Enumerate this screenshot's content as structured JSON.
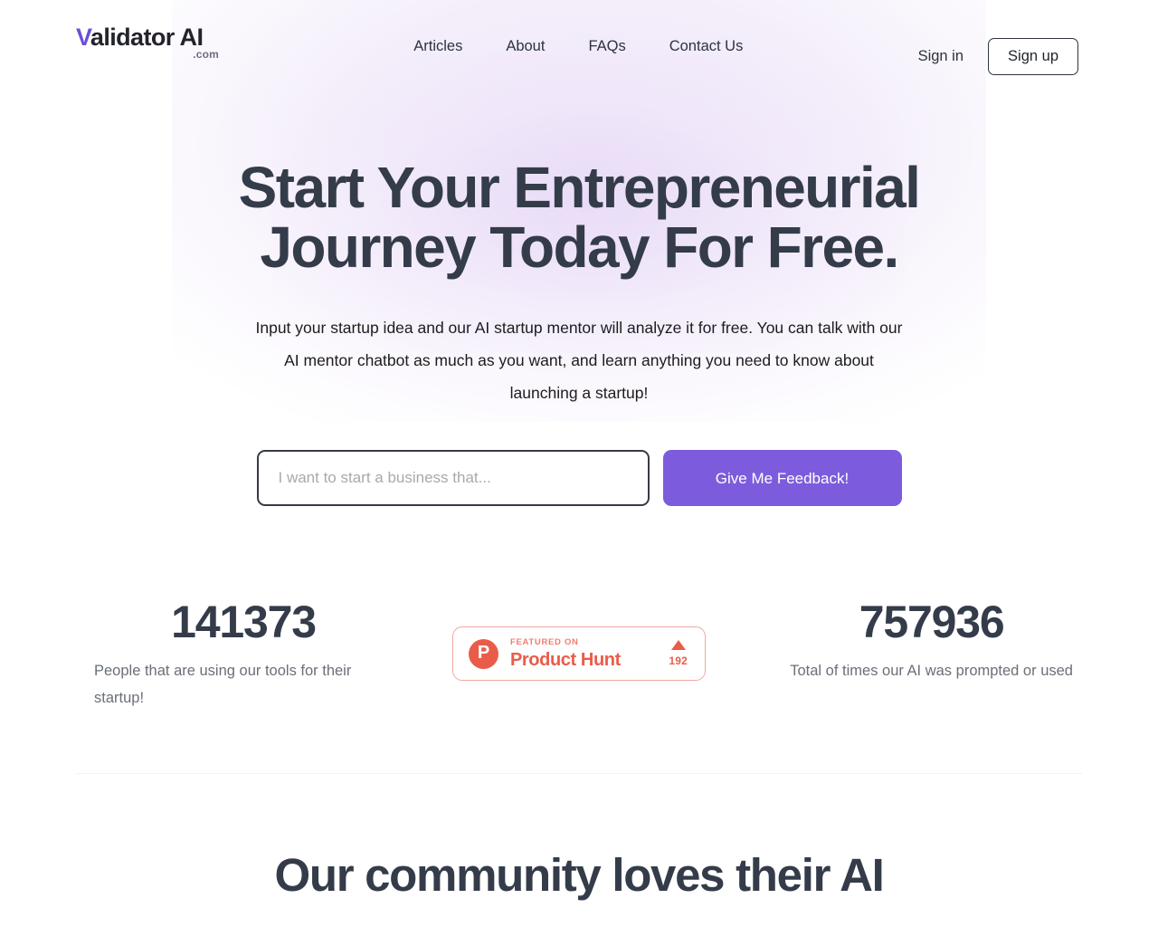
{
  "header": {
    "logo": {
      "initial": "V",
      "rest": "alidator AI",
      "tld": ".com"
    },
    "nav": [
      {
        "label": "Articles"
      },
      {
        "label": "About"
      },
      {
        "label": "FAQs"
      },
      {
        "label": "Contact Us"
      }
    ],
    "signin_label": "Sign in",
    "signup_label": "Sign up"
  },
  "hero": {
    "title_line1": "Start Your Entrepreneurial",
    "title_line2": "Journey Today For Free.",
    "subtitle": "Input your startup idea and our AI startup mentor will analyze it for free. You can talk with our AI mentor chatbot as much as you want, and learn anything you need to know about launching a startup!",
    "input_placeholder": "I want to start a business that...",
    "input_value": "",
    "cta_label": "Give Me Feedback!"
  },
  "stats": {
    "left": {
      "number": "141373",
      "description": "People that are using our tools for their startup!"
    },
    "right": {
      "number": "757936",
      "description": "Total of times our AI was prompted or used"
    }
  },
  "product_hunt": {
    "badge_letter": "P",
    "featured_label": "FEATURED ON",
    "name": "Product Hunt",
    "upvotes": "192"
  },
  "community": {
    "heading": "Our community loves their AI"
  },
  "colors": {
    "accent_purple": "#7c5cdc",
    "logo_purple": "#6c4fd6",
    "heading_slate": "#343c4a",
    "product_hunt_coral": "#ea5c4a",
    "muted_text": "#6b6f78"
  }
}
